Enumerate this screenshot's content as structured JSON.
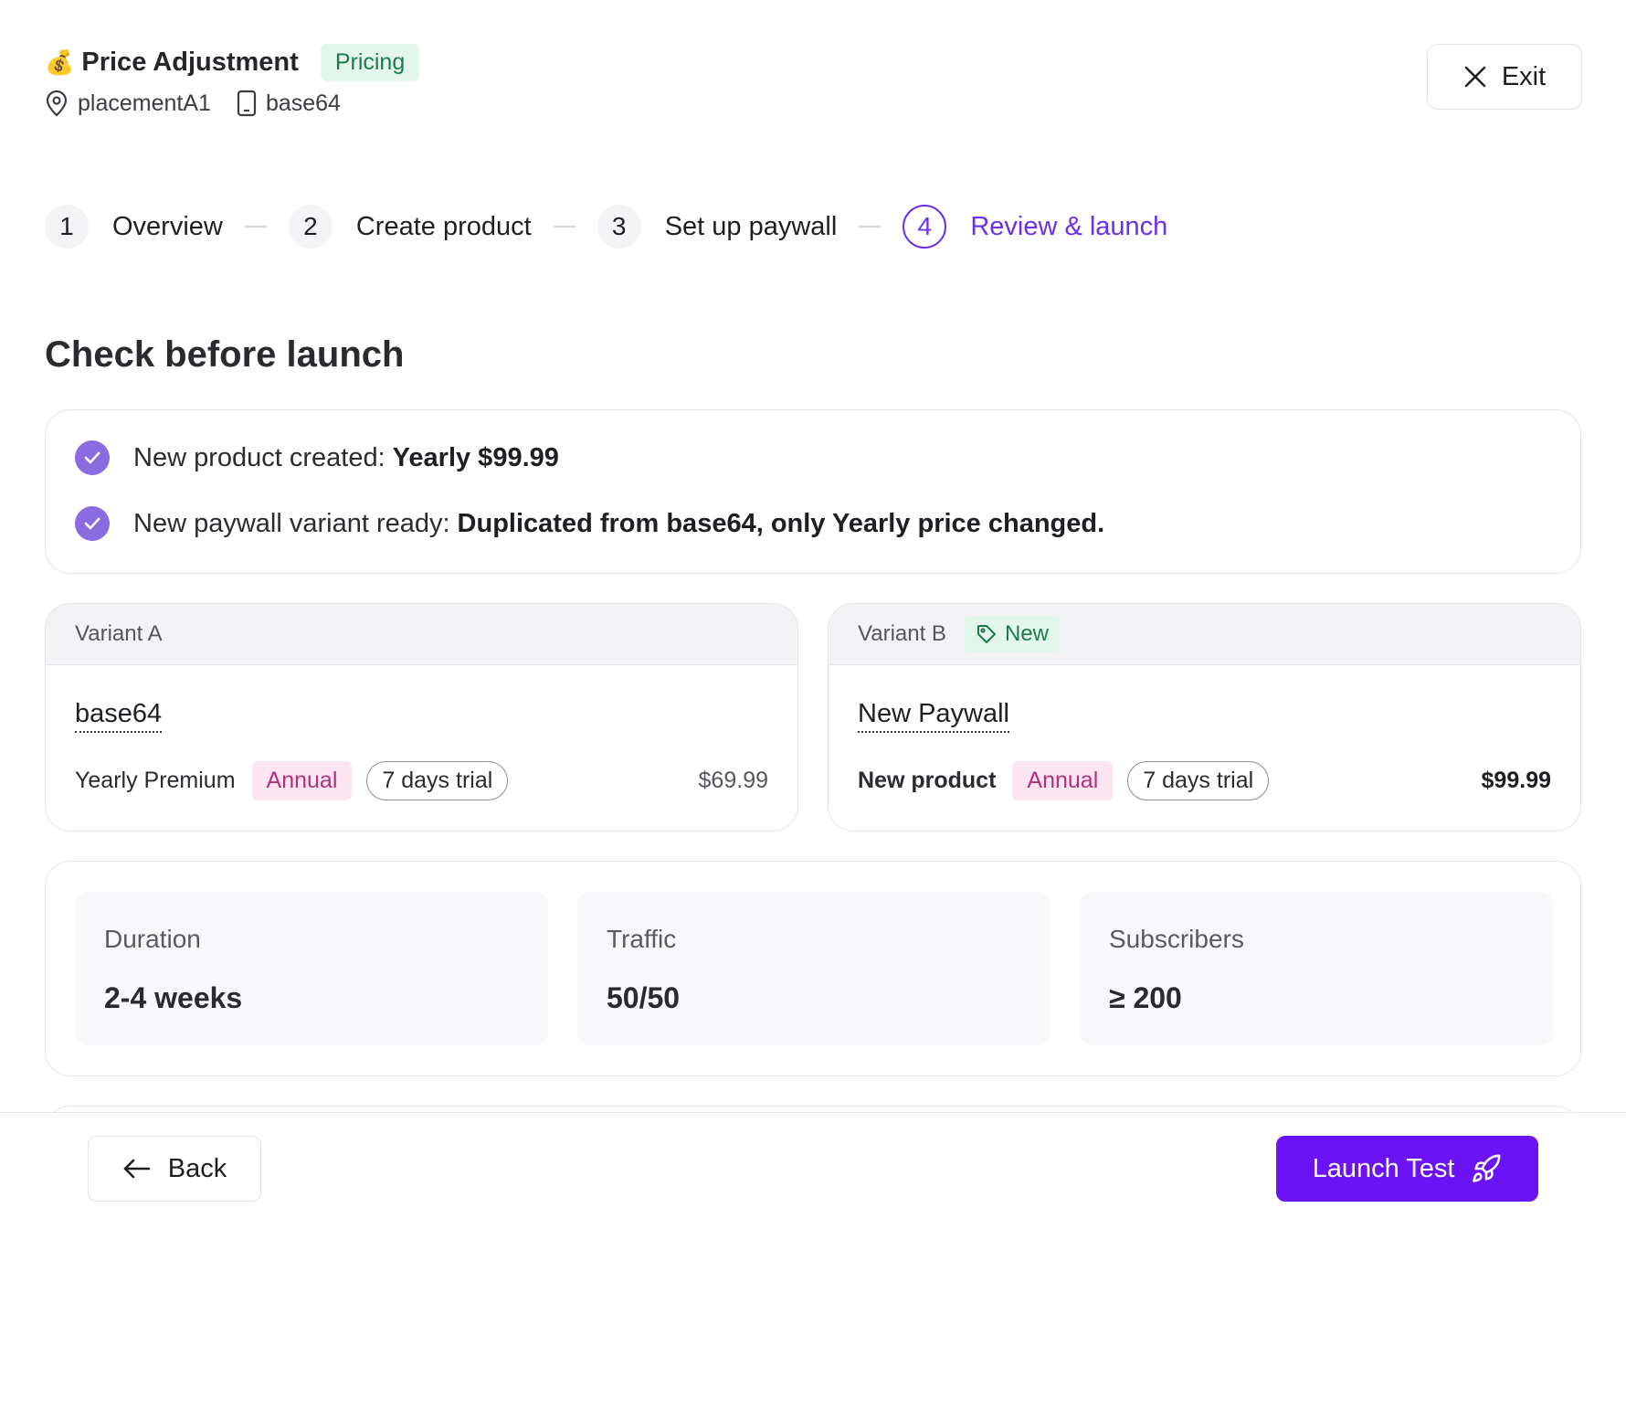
{
  "header": {
    "emoji": "💰",
    "title": "Price Adjustment",
    "badge": "Pricing",
    "placement": "placementA1",
    "paywall": "base64",
    "exit_label": "Exit"
  },
  "stepper": {
    "steps": [
      {
        "num": "1",
        "label": "Overview"
      },
      {
        "num": "2",
        "label": "Create product"
      },
      {
        "num": "3",
        "label": "Set up paywall"
      },
      {
        "num": "4",
        "label": "Review & launch"
      }
    ],
    "active_step": 4
  },
  "section_title": "Check before launch",
  "checks": [
    {
      "text": "New product created:",
      "bold": "Yearly $99.99"
    },
    {
      "text": "New paywall variant ready:",
      "bold": "Duplicated from base64, only Yearly price changed."
    }
  ],
  "variants": [
    {
      "header": "Variant A",
      "name": "base64",
      "product": "Yearly Premium",
      "period": "Annual",
      "trial": "7 days trial",
      "price": "$69.99"
    },
    {
      "header": "Variant B",
      "badge": "New",
      "name": "New Paywall",
      "product": "New product",
      "period": "Annual",
      "trial": "7 days trial",
      "price": "$99.99"
    }
  ],
  "stats": [
    {
      "label": "Duration",
      "value": "2-4 weeks"
    },
    {
      "label": "Traffic",
      "value": "50/50"
    },
    {
      "label": "Subscribers",
      "value": "≥ 200"
    }
  ],
  "footer": {
    "back_label": "Back",
    "launch_label": "Launch Test"
  },
  "colors": {
    "accent": "#6b13f5",
    "active_step": "#6b2ff0",
    "check": "#8a6be0",
    "success_bg": "#e3f6ec",
    "success_text": "#1f7a4a",
    "annual_bg": "#fde4f1",
    "annual_text": "#b0327a"
  }
}
